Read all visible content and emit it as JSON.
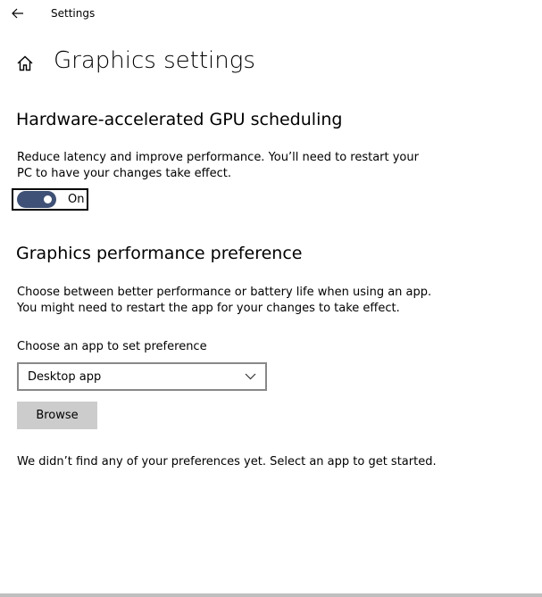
{
  "window": {
    "title": "Settings"
  },
  "page": {
    "title": "Graphics settings"
  },
  "gpu_scheduling": {
    "title": "Hardware-accelerated GPU scheduling",
    "description_line1": "Reduce latency and improve performance. You’ll need to restart your",
    "description_line2": "PC to have your changes take effect.",
    "toggle_state": "On",
    "toggle_on": true,
    "toggle_color": "#3f5176"
  },
  "performance_preference": {
    "title": "Graphics performance preference",
    "description_line1": "Choose between better performance or battery life when using an app.",
    "description_line2": "You might need to restart the app for your changes to take effect.",
    "choose_label": "Choose an app to set preference",
    "dropdown_value": "Desktop app",
    "browse_label": "Browse",
    "empty_message": "We didn’t find any of your preferences yet. Select an app to get started."
  },
  "icons": {
    "back": "back-arrow-icon",
    "home": "home-icon",
    "dropdown": "chevron-down-icon"
  }
}
